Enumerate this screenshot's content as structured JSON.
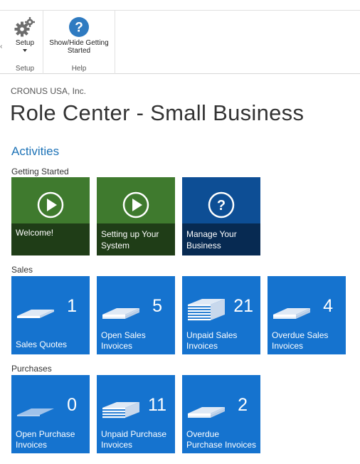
{
  "ribbon": {
    "groups": [
      {
        "name": "Setup",
        "buttons": [
          {
            "label": "Setup",
            "icon": "gears-icon",
            "has_dropdown": true
          }
        ]
      },
      {
        "name": "Help",
        "buttons": [
          {
            "label": "Show/Hide Getting Started",
            "icon": "help-circle-icon"
          }
        ]
      }
    ]
  },
  "header": {
    "company": "CRONUS USA, Inc.",
    "title": "Role Center - Small Business"
  },
  "activities": {
    "title": "Activities",
    "getting_started": {
      "label": "Getting Started",
      "tiles": [
        {
          "label": "Welcome!",
          "icon": "play-icon",
          "color": "#3f7a2e"
        },
        {
          "label": "Setting up Your System",
          "icon": "play-icon",
          "color": "#3f7a2e"
        },
        {
          "label": "Manage Your Business",
          "icon": "help-icon",
          "color": "#0d4e95"
        }
      ]
    },
    "sales": {
      "label": "Sales",
      "tiles": [
        {
          "label": "Sales Quotes",
          "count": "1",
          "icon": "document-stack-icon"
        },
        {
          "label": "Open Sales Invoices",
          "count": "5",
          "icon": "document-stack-icon"
        },
        {
          "label": "Unpaid Sales Invoices",
          "count": "21",
          "icon": "document-stack-icon"
        },
        {
          "label": "Overdue Sales Invoices",
          "count": "4",
          "icon": "document-stack-icon"
        }
      ]
    },
    "purchases": {
      "label": "Purchases",
      "tiles": [
        {
          "label": "Open Purchase Invoices",
          "count": "0",
          "icon": "document-empty-icon"
        },
        {
          "label": "Unpaid Purchase Invoices",
          "count": "11",
          "icon": "document-stack-icon"
        },
        {
          "label": "Overdue Purchase Invoices",
          "count": "2",
          "icon": "document-stack-icon"
        }
      ]
    }
  },
  "colors": {
    "accent": "#1e73b7",
    "tile_blue": "#1573cf",
    "tile_green": "#3f7a2e",
    "tile_darkblue": "#0d4e95"
  }
}
